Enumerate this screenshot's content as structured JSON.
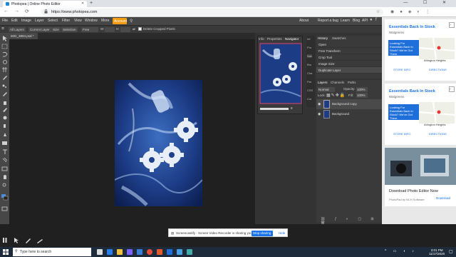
{
  "browser": {
    "tab_title": "Photopea | Online Photo Editor",
    "tab_close": "✕",
    "new_tab": "+",
    "window_controls": "— ☐ ✕",
    "url": "https://www.photopea.com",
    "nav": {
      "back": "←",
      "forward": "→",
      "reload": "⟳"
    }
  },
  "menu": {
    "items": [
      "File",
      "Edit",
      "Image",
      "Layer",
      "Select",
      "Filter",
      "View",
      "Window",
      "More"
    ],
    "account": "Account",
    "right_links": [
      "About",
      "Report a bug",
      "Learn",
      "Blog",
      "API"
    ]
  },
  "options": {
    "items": [
      "All Layers",
      "Current Layer",
      "Size",
      "Selection",
      "Free"
    ],
    "w_label": "W:",
    "h_label": "H:",
    "checkbox_label": "Delete Cropped Pixels"
  },
  "document": {
    "tab_label": "IMG_3894.psd *"
  },
  "navigator": {
    "tabs": [
      "Info",
      "Properties",
      "Navigator"
    ],
    "zoom_value": "8"
  },
  "side_tabs": [
    "Inf",
    "Pro",
    "Nav",
    "Bru",
    "Cha",
    "Par",
    "CSS",
    "Cor"
  ],
  "history": {
    "tabs": [
      "History",
      "Swatches"
    ],
    "items": [
      "Open",
      "Free Transform",
      "Crop Tool",
      "Image Size",
      "Duplicate Layer"
    ]
  },
  "layers": {
    "tabs": [
      "Layers",
      "Channels",
      "Paths"
    ],
    "blend_mode": "Normal",
    "opacity_label": "Opacity:",
    "opacity_value": "100%",
    "lock_label": "Lock:",
    "fill_label": "Fill:",
    "fill_value": "100%",
    "rows": [
      {
        "name": "Background copy"
      },
      {
        "name": "Background"
      }
    ]
  },
  "ads": [
    {
      "title": "Essentials Back In Stock",
      "brand": "Walgreens",
      "card_text": "Looking For Essentials Back In Stock? We've Got Them.",
      "map_label": "Arlington Heights",
      "store_info": "STORE INFO",
      "directions": "DIRECTIONS"
    },
    {
      "title": "Essentials Back In Stock",
      "brand": "Walgreens",
      "card_text": "Looking For Essentials Back In Stock? We've Got Them.",
      "map_label": "Arlington Heights",
      "store_info": "STORE INFO",
      "directions": "DIRECTIONS"
    }
  ],
  "ad3": {
    "title": "Download Photo Editor Now",
    "subtitle": "PhotoPad by NCH Software",
    "cta": "Download"
  },
  "screencast": {
    "message": "Screencastify - Screen Video Recorder is sharing your screen.",
    "stop_label": "Stop sharing",
    "hide_label": "Hide"
  },
  "taskbar": {
    "search_placeholder": "Type here to search",
    "time": "3:01 PM",
    "date": "11/17/2020"
  },
  "colors": {
    "accent": "#f39c12",
    "menu_bg": "#474747",
    "image_blue": "#1f3f8c",
    "link_blue": "#1a73e8"
  }
}
